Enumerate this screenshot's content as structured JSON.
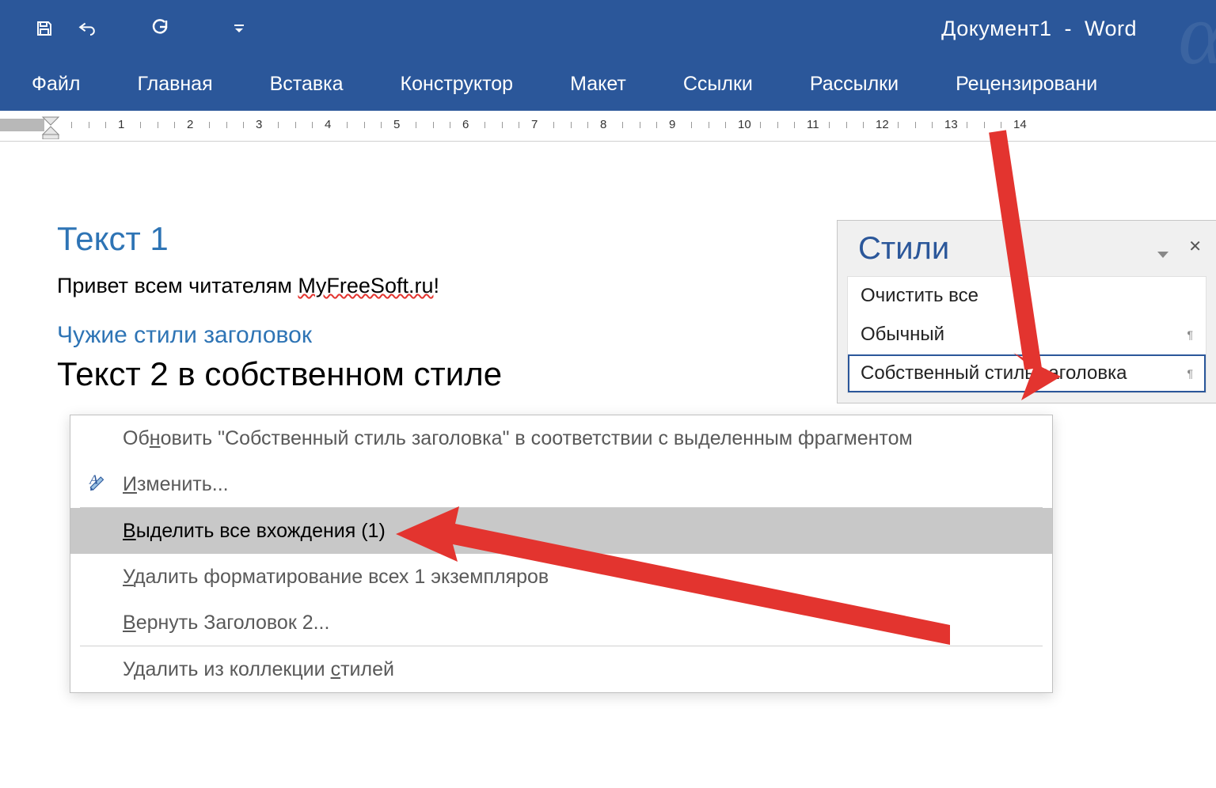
{
  "window": {
    "document_name": "Документ1",
    "separator": "-",
    "app_name": "Word"
  },
  "ribbon": {
    "tabs": [
      "Файл",
      "Главная",
      "Вставка",
      "Конструктор",
      "Макет",
      "Ссылки",
      "Рассылки",
      "Рецензировани"
    ]
  },
  "ruler": {
    "numbers": [
      1,
      2,
      3,
      4,
      5,
      6,
      7,
      8,
      9,
      10,
      11,
      12,
      13,
      14
    ]
  },
  "document": {
    "heading1": "Текст 1",
    "paragraph_prefix": "Привет всем читателям ",
    "paragraph_spell": "MyFreeSoft.ru",
    "paragraph_suffix": "!",
    "heading2": "Чужие стили заголовок",
    "custom_heading": "Текст 2 в собственном стиле"
  },
  "styles_pane": {
    "title": "Стили",
    "items": [
      {
        "label": "Очистить все",
        "mark": ""
      },
      {
        "label": "Обычный",
        "mark": "¶"
      },
      {
        "label": "Собственный стиль заголовка",
        "mark": "¶",
        "selected": true
      }
    ]
  },
  "context_menu": {
    "items": [
      {
        "prefix": "Об",
        "u": "н",
        "suffix": "овить \"Собственный стиль заголовка\" в соответствии с выделенным фрагментом",
        "icon": null
      },
      {
        "prefix": "",
        "u": "И",
        "suffix": "зменить...",
        "icon": "edit"
      },
      {
        "prefix": "",
        "u": "В",
        "suffix": "ыделить все вхождения (1)",
        "highlighted": true
      },
      {
        "prefix": "",
        "u": "У",
        "suffix": "далить форматирование всех 1 экземпляров"
      },
      {
        "prefix": "",
        "u": "В",
        "suffix": "ернуть Заголовок 2..."
      },
      {
        "prefix": "Удалить из коллекции ",
        "u": "с",
        "suffix": "тилей"
      }
    ]
  }
}
